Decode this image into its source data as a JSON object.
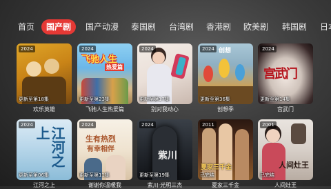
{
  "tabs": [
    {
      "label": "首页",
      "active": false
    },
    {
      "label": "国产剧",
      "active": true
    },
    {
      "label": "国产动漫",
      "active": false
    },
    {
      "label": "泰国剧",
      "active": false
    },
    {
      "label": "台湾剧",
      "active": false
    },
    {
      "label": "香港剧",
      "active": false
    },
    {
      "label": "欧美剧",
      "active": false
    },
    {
      "label": "韩国剧",
      "active": false
    },
    {
      "label": "日本",
      "active": false
    }
  ],
  "cards": [
    {
      "year": "2024",
      "episodes": "更新至第18集",
      "title": "欢乐英雄"
    },
    {
      "year": "2024",
      "episodes": "更新至第23集",
      "title": "飞驰人生热爱篇",
      "poster_text": "飞驰人生",
      "poster_subtext": "热爱篇"
    },
    {
      "year": "2024",
      "episodes": "更新至第17集",
      "title": "别对我动心"
    },
    {
      "year": "2024",
      "episodes": "更新至第36集",
      "title": "创想季",
      "poster_text": "创想"
    },
    {
      "year": "2024",
      "episodes": "更新至第14集",
      "title": "宫武门",
      "poster_text": "宫武门"
    },
    {
      "year": "2024",
      "episodes": "更新至第06集",
      "title": "江河之上",
      "poster_text": "江河之上"
    },
    {
      "year": "2024",
      "episodes": "更新至第11集",
      "title": "谢谢你温暖我",
      "poster_text": "生有热烈",
      "poster_subtext": "有幸相伴"
    },
    {
      "year": "2024",
      "episodes": "更新至第19集",
      "title": "紫川·光明三杰",
      "poster_text": "紫川"
    },
    {
      "year": "2011",
      "episodes": "已完结",
      "title": "夏家三千金",
      "poster_text": "夏家三千金"
    },
    {
      "year": "2001",
      "episodes": "已完结",
      "title": "人间灶王",
      "poster_text": "人间灶王"
    }
  ]
}
